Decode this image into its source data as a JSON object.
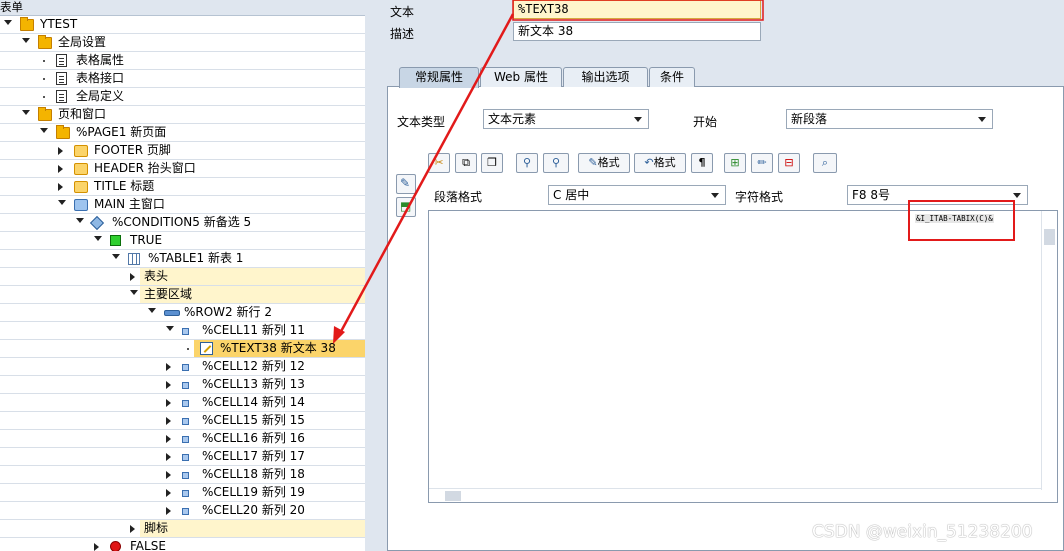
{
  "tree": {
    "header": "表单",
    "rows": [
      {
        "label": "YTEST",
        "indent": 0,
        "toggle": "open",
        "icon": "folder-icon"
      },
      {
        "label": "全局设置",
        "indent": 1,
        "toggle": "open",
        "icon": "folder-icon"
      },
      {
        "label": "表格属性",
        "indent": 2,
        "toggle": "leaf",
        "icon": "document-icon"
      },
      {
        "label": "表格接口",
        "indent": 2,
        "toggle": "leaf",
        "icon": "document-icon"
      },
      {
        "label": "全局定义",
        "indent": 2,
        "toggle": "leaf",
        "icon": "document-icon"
      },
      {
        "label": "页和窗口",
        "indent": 1,
        "toggle": "open",
        "icon": "folder-icon"
      },
      {
        "label": "%PAGE1 新页面",
        "indent": 2,
        "toggle": "open",
        "icon": "folder-icon"
      },
      {
        "label": "FOOTER 页脚",
        "indent": 3,
        "toggle": "closed",
        "icon": "window-icon"
      },
      {
        "label": "HEADER 抬头窗口",
        "indent": 3,
        "toggle": "closed",
        "icon": "window-icon"
      },
      {
        "label": "TITLE 标题",
        "indent": 3,
        "toggle": "closed",
        "icon": "window-icon"
      },
      {
        "label": "MAIN 主窗口",
        "indent": 3,
        "toggle": "open",
        "icon": "main-window-icon"
      },
      {
        "label": "%CONDITION5 新备选 5",
        "indent": 4,
        "toggle": "open",
        "icon": "condition-icon"
      },
      {
        "label": "TRUE",
        "indent": 5,
        "toggle": "open",
        "icon": "true-icon"
      },
      {
        "label": "%TABLE1 新表 1",
        "indent": 6,
        "toggle": "open",
        "icon": "table-icon"
      },
      {
        "label": "表头",
        "indent": 7,
        "toggle": "closed",
        "icon": "",
        "yellow": true
      },
      {
        "label": "主要区域",
        "indent": 7,
        "toggle": "open",
        "icon": "",
        "yellow": true
      },
      {
        "label": "%ROW2 新行 2",
        "indent": 8,
        "toggle": "open",
        "icon": "row-icon"
      },
      {
        "label": "%CELL11 新列 11",
        "indent": 9,
        "toggle": "open",
        "icon": "cell-icon"
      },
      {
        "label": "%TEXT38 新文本 38",
        "indent": 10,
        "toggle": "leaf",
        "icon": "text-node-icon",
        "selected": true
      },
      {
        "label": "%CELL12 新列 12",
        "indent": 9,
        "toggle": "closed",
        "icon": "cell-icon"
      },
      {
        "label": "%CELL13 新列 13",
        "indent": 9,
        "toggle": "closed",
        "icon": "cell-icon"
      },
      {
        "label": "%CELL14 新列 14",
        "indent": 9,
        "toggle": "closed",
        "icon": "cell-icon"
      },
      {
        "label": "%CELL15 新列 15",
        "indent": 9,
        "toggle": "closed",
        "icon": "cell-icon"
      },
      {
        "label": "%CELL16 新列 16",
        "indent": 9,
        "toggle": "closed",
        "icon": "cell-icon"
      },
      {
        "label": "%CELL17 新列 17",
        "indent": 9,
        "toggle": "closed",
        "icon": "cell-icon"
      },
      {
        "label": "%CELL18 新列 18",
        "indent": 9,
        "toggle": "closed",
        "icon": "cell-icon"
      },
      {
        "label": "%CELL19 新列 19",
        "indent": 9,
        "toggle": "closed",
        "icon": "cell-icon"
      },
      {
        "label": "%CELL20 新列 20",
        "indent": 9,
        "toggle": "closed",
        "icon": "cell-icon"
      },
      {
        "label": "脚标",
        "indent": 7,
        "toggle": "closed",
        "icon": "",
        "yellow": true
      },
      {
        "label": "FALSE",
        "indent": 5,
        "toggle": "closed",
        "icon": "false-icon"
      }
    ]
  },
  "header_fields": {
    "text_label": "文本",
    "text_value": "%TEXT38",
    "desc_label": "描述",
    "desc_value": "新文本 38"
  },
  "tabs": [
    "常规属性",
    "Web 属性",
    "输出选项",
    "条件"
  ],
  "general": {
    "text_type_label": "文本类型",
    "text_type_value": "文本元素",
    "start_label": "开始",
    "start_value": "新段落"
  },
  "toolbar": {
    "format_btn1": "格式",
    "format_btn2": "格式",
    "para_mark": "¶"
  },
  "editor": {
    "para_format_label": "段落格式",
    "para_format_value": "C 居中",
    "char_format_label": "字符格式",
    "char_format_value": "F8 8号",
    "code_text": "&I_ITAB-TABIX(C)&"
  },
  "watermark": "CSDN @weixin_51238200",
  "colors": {
    "highlight_red": "#e21a1a",
    "selected_row": "#fbd46a",
    "yellow_row": "#fff5cc"
  }
}
